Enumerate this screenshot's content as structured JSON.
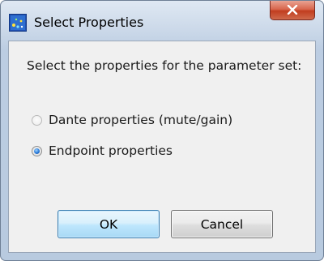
{
  "window": {
    "title": "Select Properties",
    "icon": "app-icon",
    "close_icon": "close-icon"
  },
  "dialog": {
    "prompt": "Select the properties for the parameter set:",
    "options": [
      {
        "label": "Dante properties (mute/gain)",
        "selected": false,
        "enabled": false
      },
      {
        "label": "Endpoint properties",
        "selected": true,
        "enabled": true
      }
    ],
    "ok_label": "OK",
    "cancel_label": "Cancel"
  },
  "colors": {
    "frame": "#c9d7e8",
    "close_button": "#c13d1f",
    "ok_border": "#3c7fb1",
    "client_bg": "#f0f0f0"
  }
}
